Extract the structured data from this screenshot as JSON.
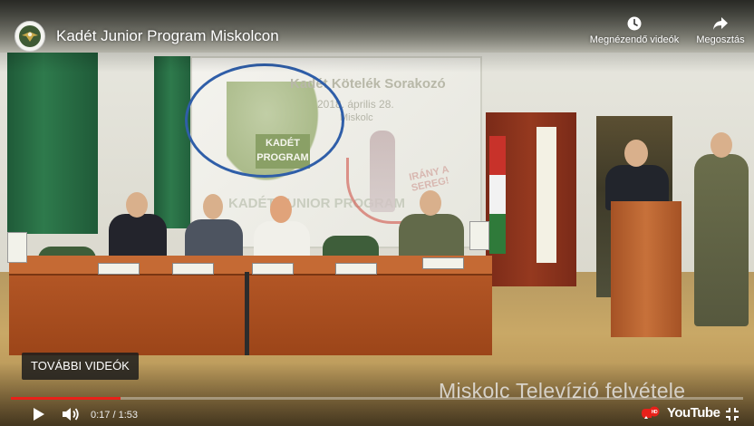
{
  "header": {
    "title": "Kadét Junior Program Miskolcon",
    "channel_icon": "channel-avatar-icon",
    "watch_later_label": "Megnézendő videók",
    "share_label": "Megosztás"
  },
  "slide": {
    "line1": "Kadét Kötelék Sorakozó",
    "line2": "2018. április 28.",
    "line3": "Miskolc",
    "logo_text": "KADÉT PROGRAM",
    "program_text": "KADÉT JUNIOR PROGRAM",
    "slogan": "IRÁNY A SEREG!"
  },
  "overlay": {
    "more_videos": "TOVÁBBI VIDEÓK",
    "watermark": "Miskolc Televízió felvétele"
  },
  "controls": {
    "current_time": "0:17",
    "duration": "1:53",
    "time_text": "0:17 / 1:53",
    "progress": 0.15,
    "youtube_label": "YouTube",
    "accent_color": "#e8211a"
  }
}
